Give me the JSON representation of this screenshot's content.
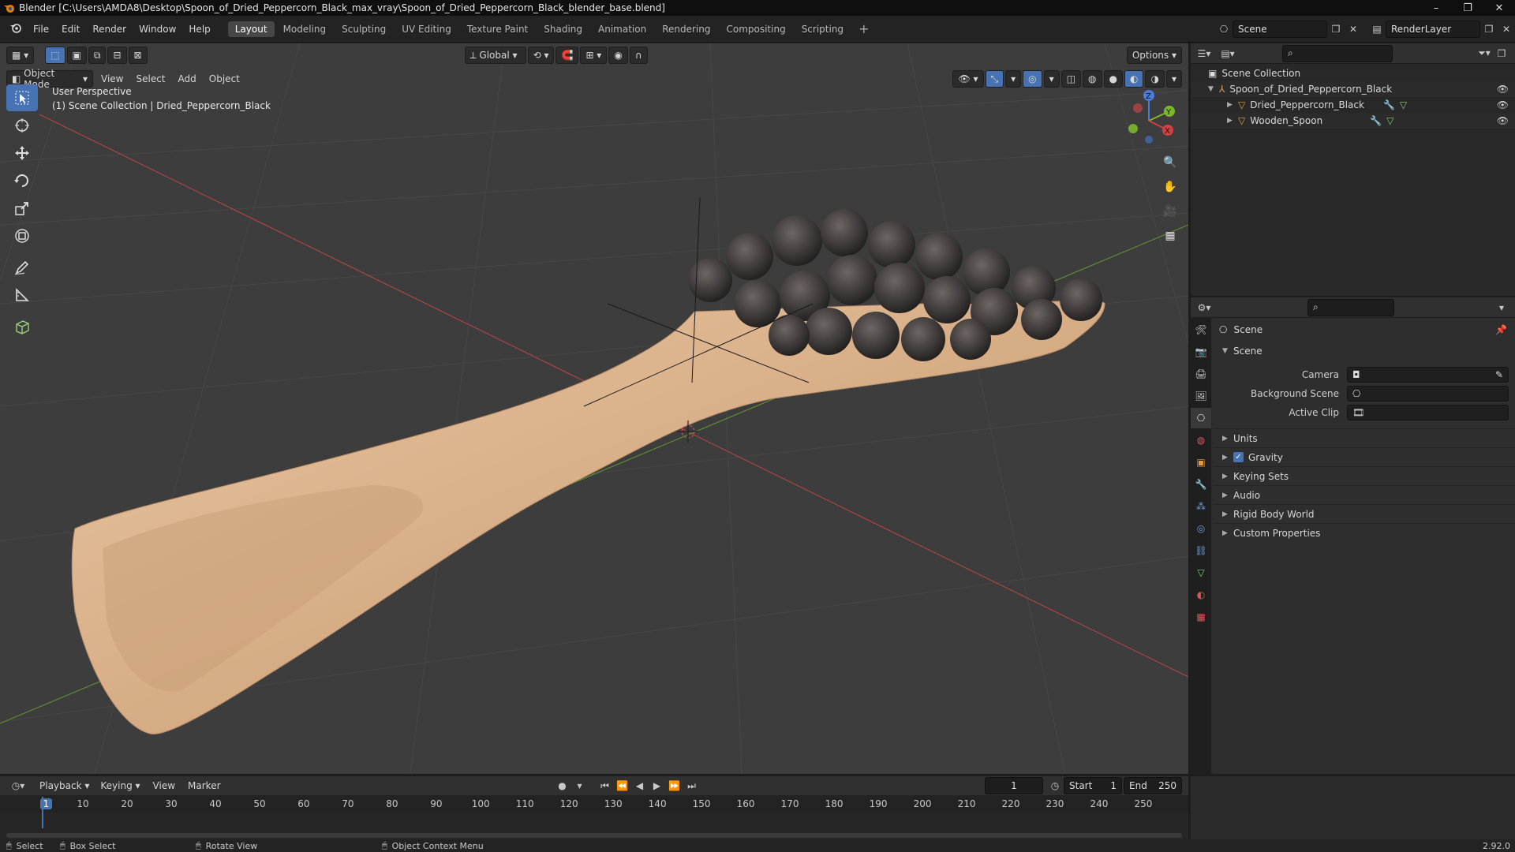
{
  "window": {
    "title": "Blender [C:\\Users\\AMDA8\\Desktop\\Spoon_of_Dried_Peppercorn_Black_max_vray\\Spoon_of_Dried_Peppercorn_Black_blender_base.blend]",
    "minimize": "–",
    "maximize": "❐",
    "close": "✕"
  },
  "menu": [
    "File",
    "Edit",
    "Render",
    "Window",
    "Help"
  ],
  "workspaces": [
    "Layout",
    "Modeling",
    "Sculpting",
    "UV Editing",
    "Texture Paint",
    "Shading",
    "Animation",
    "Rendering",
    "Compositing",
    "Scripting"
  ],
  "workspace_active": "Layout",
  "scene_field": "Scene",
  "renderlayer_field": "RenderLayer",
  "viewport": {
    "transform_orientation": "Global",
    "options_label": "Options",
    "mode": "Object Mode",
    "menus": [
      "View",
      "Select",
      "Add",
      "Object"
    ],
    "info_line1": "User Perspective",
    "info_line2": "(1) Scene Collection | Dried_Peppercorn_Black",
    "gizmo": {
      "x": "X",
      "y": "Y",
      "z": "Z"
    }
  },
  "outliner": {
    "root": "Scene Collection",
    "collection": "Spoon_of_Dried_Peppercorn_Black",
    "objects": [
      "Dried_Peppercorn_Black",
      "Wooden_Spoon"
    ]
  },
  "properties": {
    "header": "Scene",
    "section": "Scene",
    "fields": [
      {
        "label": "Camera",
        "value": ""
      },
      {
        "label": "Background Scene",
        "value": ""
      },
      {
        "label": "Active Clip",
        "value": ""
      }
    ],
    "panels": [
      "Units",
      "Gravity",
      "Keying Sets",
      "Audio",
      "Rigid Body World",
      "Custom Properties"
    ],
    "gravity_checked": true
  },
  "timeline": {
    "menus": [
      "Playback",
      "Keying",
      "View",
      "Marker"
    ],
    "current_frame": "1",
    "start_label": "Start",
    "start_value": "1",
    "end_label": "End",
    "end_value": "250",
    "ruler": [
      {
        "frame": 1,
        "label": "1"
      },
      {
        "frame": 10,
        "label": "10"
      },
      {
        "frame": 20,
        "label": "20"
      },
      {
        "frame": 30,
        "label": "30"
      },
      {
        "frame": 40,
        "label": "40"
      },
      {
        "frame": 50,
        "label": "50"
      },
      {
        "frame": 60,
        "label": "60"
      },
      {
        "frame": 70,
        "label": "70"
      },
      {
        "frame": 80,
        "label": "80"
      },
      {
        "frame": 90,
        "label": "90"
      },
      {
        "frame": 100,
        "label": "100"
      },
      {
        "frame": 110,
        "label": "110"
      },
      {
        "frame": 120,
        "label": "120"
      },
      {
        "frame": 130,
        "label": "130"
      },
      {
        "frame": 140,
        "label": "140"
      },
      {
        "frame": 150,
        "label": "150"
      },
      {
        "frame": 160,
        "label": "160"
      },
      {
        "frame": 170,
        "label": "170"
      },
      {
        "frame": 180,
        "label": "180"
      },
      {
        "frame": 190,
        "label": "190"
      },
      {
        "frame": 200,
        "label": "200"
      },
      {
        "frame": 210,
        "label": "210"
      },
      {
        "frame": 220,
        "label": "220"
      },
      {
        "frame": 230,
        "label": "230"
      },
      {
        "frame": 240,
        "label": "240"
      },
      {
        "frame": 250,
        "label": "250"
      }
    ]
  },
  "status": {
    "select": "Select",
    "box_select": "Box Select",
    "rotate_view": "Rotate View",
    "context_menu": "Object Context Menu",
    "version": "2.92.0"
  },
  "colors": {
    "accent": "#4772b3",
    "viewport_bg": "#3d3d3d",
    "axis_x": "#c24a4a",
    "axis_y": "#6a9a3a",
    "wood": "#d8b08a",
    "peppercorn": "#3f3b3a"
  }
}
